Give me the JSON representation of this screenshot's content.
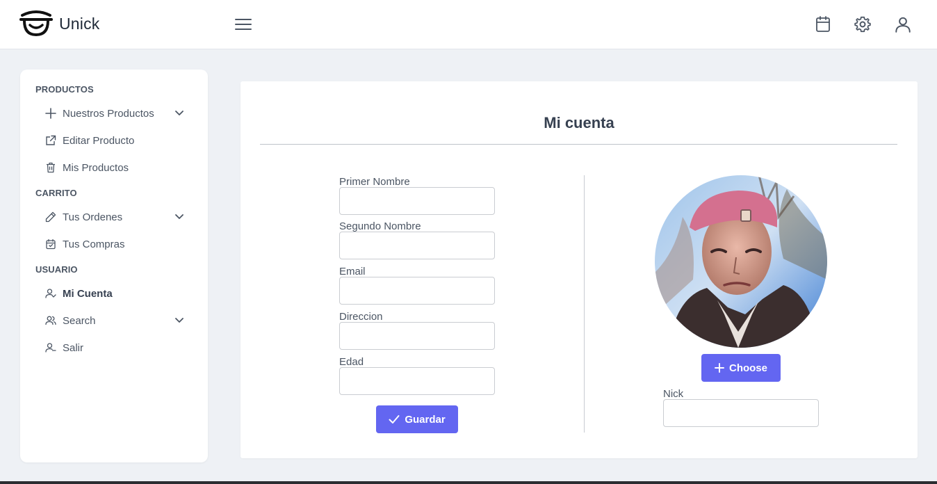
{
  "header": {
    "brand": "Unick",
    "icons": [
      "calendar-icon",
      "gear-icon",
      "user-icon"
    ]
  },
  "sidebar": {
    "sections": [
      {
        "title": "PRODUCTOS",
        "items": [
          {
            "label": "Nuestros Productos",
            "icon": "plus-icon",
            "has_submenu": true
          },
          {
            "label": "Editar Producto",
            "icon": "external-edit-icon",
            "has_submenu": false
          },
          {
            "label": "Mis Productos",
            "icon": "trash-icon",
            "has_submenu": false
          }
        ]
      },
      {
        "title": "CARRITO",
        "items": [
          {
            "label": "Tus Ordenes",
            "icon": "pencil-icon",
            "has_submenu": true
          },
          {
            "label": "Tus Compras",
            "icon": "calendar-check-icon",
            "has_submenu": false
          }
        ]
      },
      {
        "title": "USUARIO",
        "items": [
          {
            "label": "Mi Cuenta",
            "icon": "user-check-icon",
            "has_submenu": false,
            "active": true
          },
          {
            "label": "Search",
            "icon": "users-icon",
            "has_submenu": true
          },
          {
            "label": "Salir",
            "icon": "user-minus-icon",
            "has_submenu": false
          }
        ]
      }
    ]
  },
  "main": {
    "title": "Mi cuenta",
    "form": {
      "fields": [
        {
          "label": "Primer Nombre",
          "value": ""
        },
        {
          "label": "Segundo Nombre",
          "value": ""
        },
        {
          "label": "Email",
          "value": ""
        },
        {
          "label": "Direccion",
          "value": ""
        },
        {
          "label": "Edad",
          "value": ""
        }
      ],
      "save_label": "Guardar"
    },
    "profile": {
      "choose_label": "Choose",
      "nick_label": "Nick",
      "nick_value": ""
    }
  },
  "colors": {
    "accent": "#6366f1",
    "background": "#eef1f5",
    "text": "#4b5563"
  }
}
